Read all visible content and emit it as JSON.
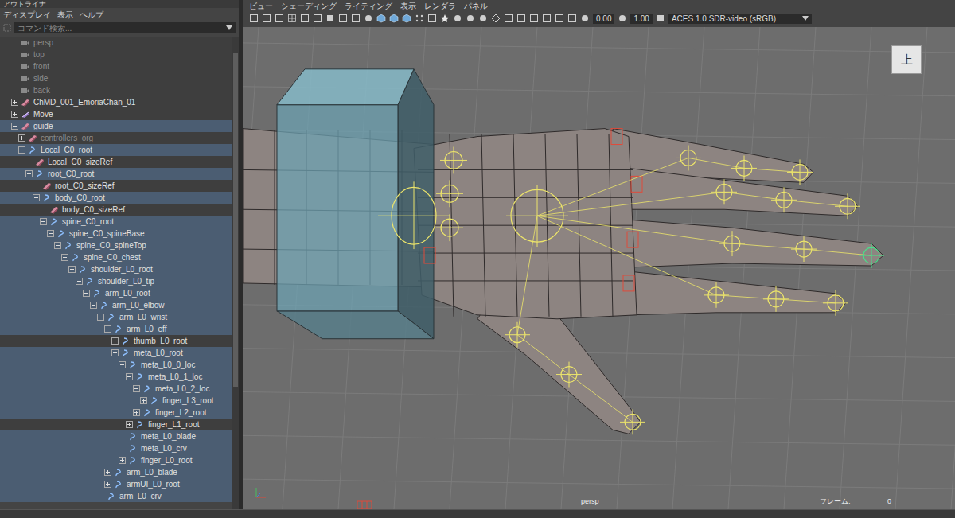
{
  "outliner": {
    "title": "アウトライナ",
    "menu": [
      "ディスプレイ",
      "表示",
      "ヘルプ"
    ],
    "search": {
      "placeholder": "コマンド検索..."
    },
    "items": [
      {
        "label": "persp",
        "kind": "camera",
        "depth": 0,
        "expandable": false,
        "expanded": false,
        "selected": false,
        "dimmed": true
      },
      {
        "label": "top",
        "kind": "camera",
        "depth": 0,
        "expandable": false,
        "expanded": false,
        "selected": false,
        "dimmed": true
      },
      {
        "label": "front",
        "kind": "camera",
        "depth": 0,
        "expandable": false,
        "expanded": false,
        "selected": false,
        "dimmed": true
      },
      {
        "label": "side",
        "kind": "camera",
        "depth": 0,
        "expandable": false,
        "expanded": false,
        "selected": false,
        "dimmed": true
      },
      {
        "label": "back",
        "kind": "camera",
        "depth": 0,
        "expandable": false,
        "expanded": false,
        "selected": false,
        "dimmed": true
      },
      {
        "label": "ChMD_001_EmoriaChan_01",
        "kind": "transform",
        "depth": 0,
        "expandable": true,
        "expanded": false,
        "selected": false,
        "dimmed": false
      },
      {
        "label": "Move",
        "kind": "group",
        "depth": 0,
        "expandable": true,
        "expanded": false,
        "selected": false,
        "dimmed": false
      },
      {
        "label": "guide",
        "kind": "transform",
        "depth": 0,
        "expandable": true,
        "expanded": true,
        "selected": true,
        "dimmed": false
      },
      {
        "label": "controllers_org",
        "kind": "transform",
        "depth": 1,
        "expandable": true,
        "expanded": false,
        "selected": false,
        "dimmed": true
      },
      {
        "label": "Local_C0_root",
        "kind": "curve",
        "depth": 1,
        "expandable": true,
        "expanded": true,
        "selected": true,
        "dimmed": false
      },
      {
        "label": "Local_C0_sizeRef",
        "kind": "transform",
        "depth": 2,
        "expandable": false,
        "expanded": false,
        "selected": false,
        "dimmed": false
      },
      {
        "label": "root_C0_root",
        "kind": "curve",
        "depth": 2,
        "expandable": true,
        "expanded": true,
        "selected": true,
        "dimmed": false
      },
      {
        "label": "root_C0_sizeRef",
        "kind": "transform",
        "depth": 3,
        "expandable": false,
        "expanded": false,
        "selected": false,
        "dimmed": false
      },
      {
        "label": "body_C0_root",
        "kind": "curve",
        "depth": 3,
        "expandable": true,
        "expanded": true,
        "selected": true,
        "dimmed": false
      },
      {
        "label": "body_C0_sizeRef",
        "kind": "transform",
        "depth": 4,
        "expandable": false,
        "expanded": false,
        "selected": false,
        "dimmed": false
      },
      {
        "label": "spine_C0_root",
        "kind": "curve",
        "depth": 4,
        "expandable": true,
        "expanded": true,
        "selected": true,
        "dimmed": false
      },
      {
        "label": "spine_C0_spineBase",
        "kind": "curve",
        "depth": 5,
        "expandable": true,
        "expanded": true,
        "selected": true,
        "dimmed": false
      },
      {
        "label": "spine_C0_spineTop",
        "kind": "curve",
        "depth": 6,
        "expandable": true,
        "expanded": true,
        "selected": true,
        "dimmed": false
      },
      {
        "label": "spine_C0_chest",
        "kind": "curve",
        "depth": 7,
        "expandable": true,
        "expanded": true,
        "selected": true,
        "dimmed": false
      },
      {
        "label": "shoulder_L0_root",
        "kind": "curve",
        "depth": 8,
        "expandable": true,
        "expanded": true,
        "selected": true,
        "dimmed": false
      },
      {
        "label": "shoulder_L0_tip",
        "kind": "curve",
        "depth": 9,
        "expandable": true,
        "expanded": true,
        "selected": true,
        "dimmed": false
      },
      {
        "label": "arm_L0_root",
        "kind": "curve",
        "depth": 10,
        "expandable": true,
        "expanded": true,
        "selected": true,
        "dimmed": false
      },
      {
        "label": "arm_L0_elbow",
        "kind": "curve",
        "depth": 11,
        "expandable": true,
        "expanded": true,
        "selected": true,
        "dimmed": false
      },
      {
        "label": "arm_L0_wrist",
        "kind": "curve",
        "depth": 12,
        "expandable": true,
        "expanded": true,
        "selected": true,
        "dimmed": false
      },
      {
        "label": "arm_L0_eff",
        "kind": "curve",
        "depth": 13,
        "expandable": true,
        "expanded": true,
        "selected": true,
        "dimmed": false
      },
      {
        "label": "thumb_L0_root",
        "kind": "curve",
        "depth": 14,
        "expandable": true,
        "expanded": false,
        "selected": false,
        "dimmed": false
      },
      {
        "label": "meta_L0_root",
        "kind": "curve",
        "depth": 14,
        "expandable": true,
        "expanded": true,
        "selected": true,
        "dimmed": false
      },
      {
        "label": "meta_L0_0_loc",
        "kind": "curve",
        "depth": 15,
        "expandable": true,
        "expanded": true,
        "selected": true,
        "dimmed": false
      },
      {
        "label": "meta_L0_1_loc",
        "kind": "curve",
        "depth": 16,
        "expandable": true,
        "expanded": true,
        "selected": true,
        "dimmed": false
      },
      {
        "label": "meta_L0_2_loc",
        "kind": "curve",
        "depth": 17,
        "expandable": true,
        "expanded": true,
        "selected": true,
        "dimmed": false
      },
      {
        "label": "finger_L3_root",
        "kind": "curve",
        "depth": 18,
        "expandable": true,
        "expanded": false,
        "selected": true,
        "dimmed": false
      },
      {
        "label": "finger_L2_root",
        "kind": "curve",
        "depth": 17,
        "expandable": true,
        "expanded": false,
        "selected": true,
        "dimmed": false
      },
      {
        "label": "finger_L1_root",
        "kind": "curve",
        "depth": 16,
        "expandable": true,
        "expanded": false,
        "selected": false,
        "dimmed": false
      },
      {
        "label": "meta_L0_blade",
        "kind": "curve",
        "depth": 15,
        "expandable": false,
        "expanded": false,
        "selected": true,
        "dimmed": false
      },
      {
        "label": "meta_L0_crv",
        "kind": "curve",
        "depth": 15,
        "expandable": false,
        "expanded": false,
        "selected": true,
        "dimmed": false
      },
      {
        "label": "finger_L0_root",
        "kind": "curve",
        "depth": 15,
        "expandable": true,
        "expanded": false,
        "selected": true,
        "dimmed": false
      },
      {
        "label": "arm_L0_blade",
        "kind": "curve",
        "depth": 13,
        "expandable": true,
        "expanded": false,
        "selected": true,
        "dimmed": false
      },
      {
        "label": "armUI_L0_root",
        "kind": "curve",
        "depth": 13,
        "expandable": true,
        "expanded": false,
        "selected": true,
        "dimmed": false
      },
      {
        "label": "arm_L0_crv",
        "kind": "curve",
        "depth": 12,
        "expandable": false,
        "expanded": false,
        "selected": true,
        "dimmed": false
      }
    ]
  },
  "viewport": {
    "menu": [
      "ビュー",
      "シェーディング",
      "ライティング",
      "表示",
      "レンダラ",
      "パネル"
    ],
    "toolbar": {
      "exposure": "0.00",
      "gamma": "1.00",
      "colorSpace": "ACES 1.0 SDR-video (sRGB)"
    },
    "viewCube": "上",
    "camera": "persp",
    "frameLabel": "フレーム:",
    "frame": "0"
  }
}
